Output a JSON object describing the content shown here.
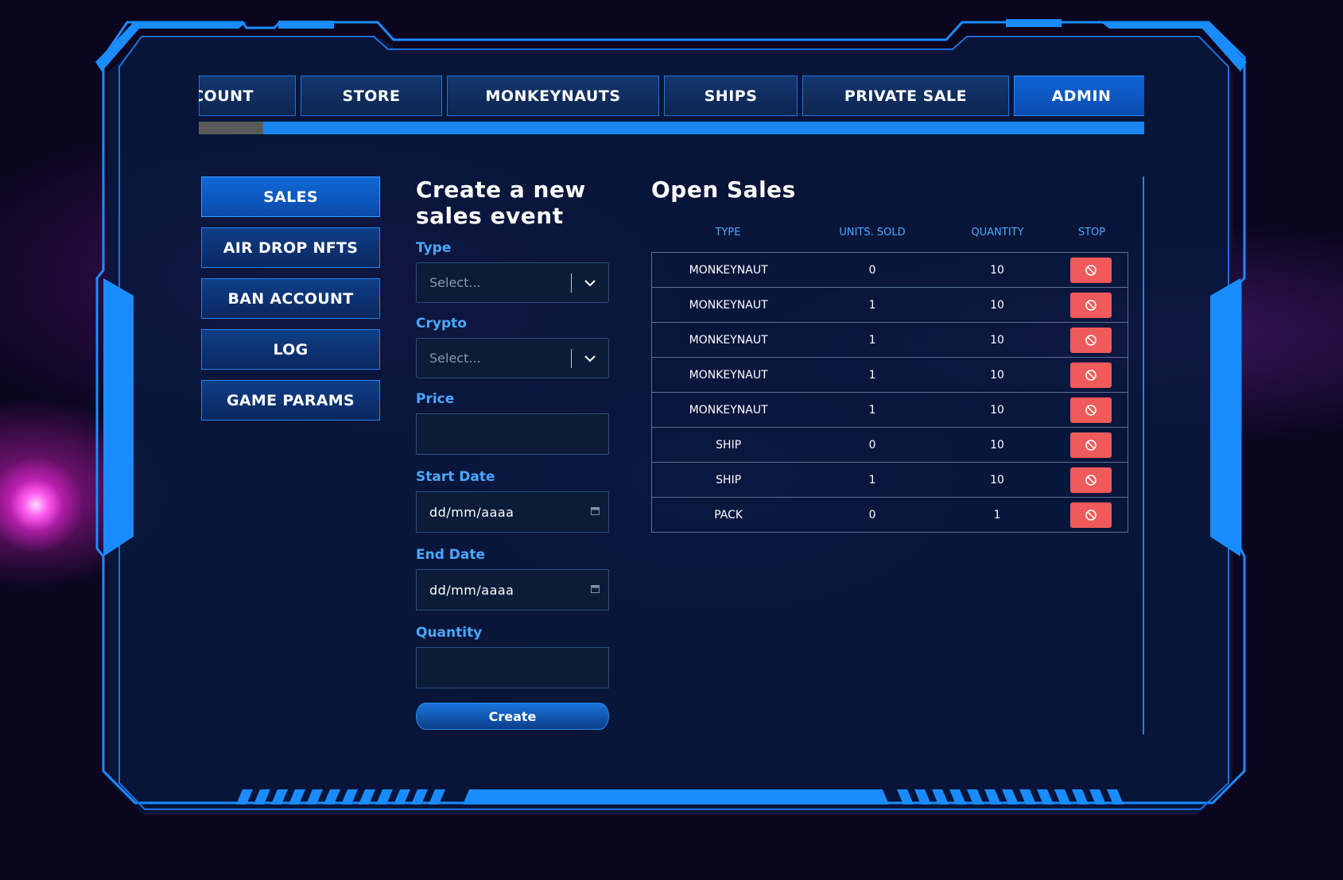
{
  "nav": {
    "tabs": [
      {
        "label": "COUNT",
        "active": false
      },
      {
        "label": "STORE",
        "active": false
      },
      {
        "label": "MONKEYNAUTS",
        "active": false
      },
      {
        "label": "SHIPS",
        "active": false
      },
      {
        "label": "PRIVATE SALE",
        "active": false
      },
      {
        "label": "ADMIN",
        "active": true
      }
    ]
  },
  "sidebar": {
    "items": [
      {
        "label": "SALES",
        "active": true
      },
      {
        "label": "AIR DROP NFTS",
        "active": false
      },
      {
        "label": "BAN ACCOUNT",
        "active": false
      },
      {
        "label": "LOG",
        "active": false
      },
      {
        "label": "GAME PARAMS",
        "active": false
      }
    ]
  },
  "form": {
    "title": "Create a new sales event",
    "type_label": "Type",
    "type_placeholder": "Select...",
    "crypto_label": "Crypto",
    "crypto_placeholder": "Select...",
    "price_label": "Price",
    "price_value": "",
    "start_label": "Start Date",
    "start_value": "dd/mm/aaaa",
    "end_label": "End Date",
    "end_value": "dd/mm/aaaa",
    "quantity_label": "Quantity",
    "quantity_value": "",
    "create_label": "Create"
  },
  "sales": {
    "title": "Open Sales",
    "headers": [
      "TYPE",
      "UNITS. SOLD",
      "QUANTITY",
      "STOP"
    ],
    "rows": [
      {
        "type": "MONKEYNAUT",
        "sold": "0",
        "qty": "10"
      },
      {
        "type": "MONKEYNAUT",
        "sold": "1",
        "qty": "10"
      },
      {
        "type": "MONKEYNAUT",
        "sold": "1",
        "qty": "10"
      },
      {
        "type": "MONKEYNAUT",
        "sold": "1",
        "qty": "10"
      },
      {
        "type": "MONKEYNAUT",
        "sold": "1",
        "qty": "10"
      },
      {
        "type": "SHIP",
        "sold": "0",
        "qty": "10"
      },
      {
        "type": "SHIP",
        "sold": "1",
        "qty": "10"
      },
      {
        "type": "PACK",
        "sold": "0",
        "qty": "1"
      }
    ]
  },
  "colors": {
    "accent": "#1a86ef",
    "stop": "#ef5a5a",
    "label": "#4aa8ff"
  }
}
